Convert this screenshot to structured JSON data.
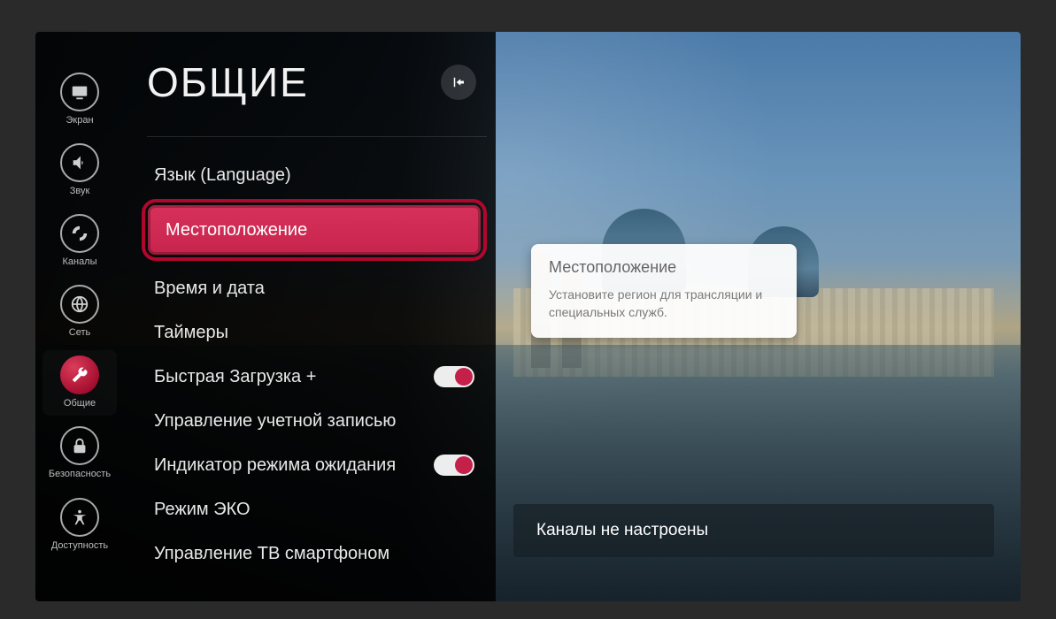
{
  "sidebar": {
    "items": [
      {
        "id": "screen",
        "label": "Экран"
      },
      {
        "id": "sound",
        "label": "Звук"
      },
      {
        "id": "channels",
        "label": "Каналы"
      },
      {
        "id": "network",
        "label": "Сеть"
      },
      {
        "id": "general",
        "label": "Общие"
      },
      {
        "id": "safety",
        "label": "Безопасность"
      },
      {
        "id": "accessibility",
        "label": "Доступность"
      }
    ],
    "active_index": 4
  },
  "header": {
    "title": "ОБЩИЕ"
  },
  "menu": {
    "items": [
      {
        "id": "language",
        "label": "Язык (Language)",
        "toggle": null
      },
      {
        "id": "location",
        "label": "Местоположение",
        "toggle": null
      },
      {
        "id": "datetime",
        "label": "Время и дата",
        "toggle": null
      },
      {
        "id": "timers",
        "label": "Таймеры",
        "toggle": null
      },
      {
        "id": "quickstart",
        "label": "Быстрая Загрузка +",
        "toggle": true
      },
      {
        "id": "account",
        "label": "Управление учетной записью",
        "toggle": null
      },
      {
        "id": "standby-led",
        "label": "Индикатор режима ожидания",
        "toggle": true
      },
      {
        "id": "eco",
        "label": "Режим ЭКО",
        "toggle": null
      },
      {
        "id": "phone-control",
        "label": "Управление ТВ смартфоном",
        "toggle": null
      }
    ],
    "selected_index": 1
  },
  "tooltip": {
    "title": "Местоположение",
    "body": "Установите регион для трансляции и специальных служб."
  },
  "bottom_bar": {
    "text": "Каналы не настроены"
  }
}
